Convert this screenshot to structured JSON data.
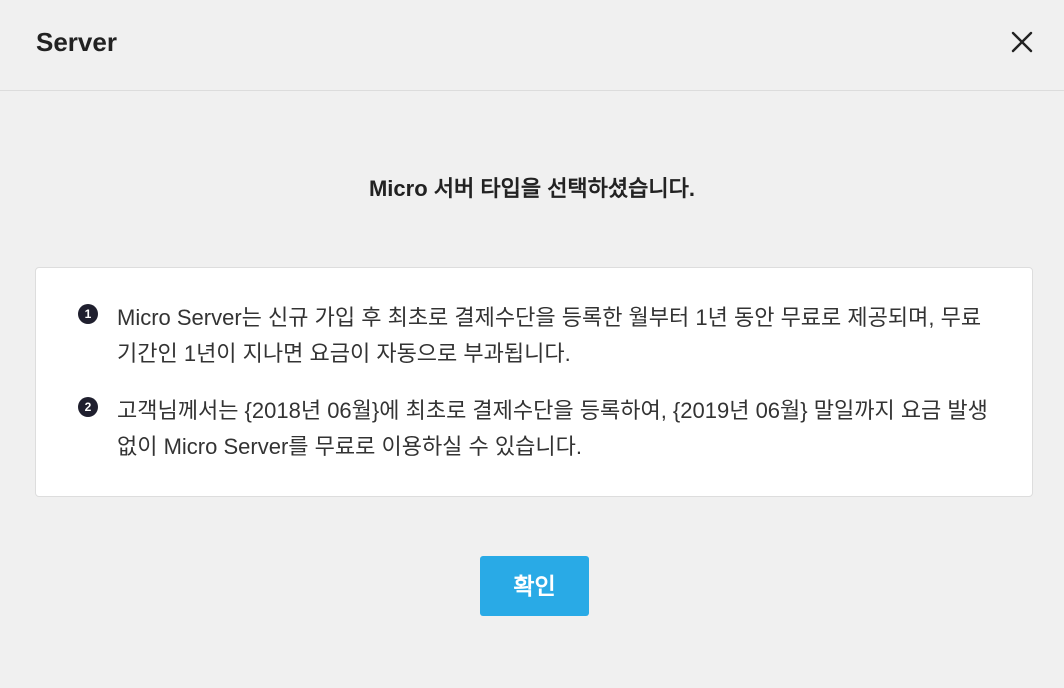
{
  "dialog": {
    "title": "Server",
    "close_icon": "close-icon",
    "headline": "Micro 서버 타입을 선택하셨습니다.",
    "info_items": [
      {
        "number": "1",
        "text": "Micro Server는 신규 가입 후 최초로 결제수단을 등록한 월부터 1년 동안 무료로 제공되며, 무료 기간인 1년이 지나면 요금이 자동으로 부과됩니다."
      },
      {
        "number": "2",
        "text": "고객님께서는 {2018년 06월}에 최초로 결제수단을 등록하여, {2019년 06월} 말일까지 요금 발생 없이 Micro Server를 무료로 이용하실 수 있습니다."
      }
    ],
    "confirm_label": "확인"
  },
  "colors": {
    "background": "#f0f0f0",
    "box_background": "#ffffff",
    "accent": "#29aae6",
    "badge": "#1f1f2e"
  }
}
